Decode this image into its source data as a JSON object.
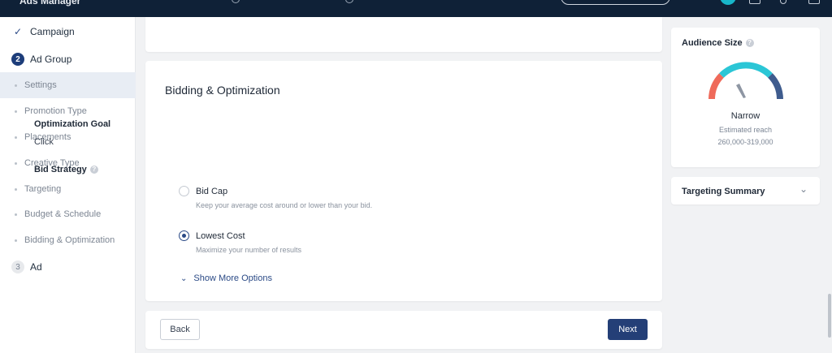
{
  "topbar": {
    "title": "Ads Manager"
  },
  "sidebar": {
    "steps": [
      {
        "num": "✓",
        "label": "Campaign"
      },
      {
        "num": "2",
        "label": "Ad Group"
      },
      {
        "num": "3",
        "label": "Ad"
      }
    ],
    "substeps": [
      "Settings",
      "Promotion Type",
      "Placements",
      "Creative Type",
      "Targeting",
      "Budget & Schedule",
      "Bidding & Optimization"
    ]
  },
  "main": {
    "title": "Bidding & Optimization",
    "optimization_goal": {
      "label": "Optimization Goal",
      "value": "Click"
    },
    "bid_strategy": {
      "label": "Bid Strategy",
      "options": [
        {
          "label": "Bid Cap",
          "desc": "Keep your average cost around or lower than your bid.",
          "selected": false
        },
        {
          "label": "Lowest Cost",
          "desc": "Maximize your number of results",
          "selected": true
        }
      ]
    },
    "show_more": "Show More Options",
    "back_label": "Back",
    "next_label": "Next"
  },
  "right": {
    "audience_title": "Audience Size",
    "gauge_status": "Narrow",
    "reach_label": "Estimated reach",
    "reach_value": "260,000-319,000",
    "targeting_summary": "Targeting Summary"
  },
  "colors": {
    "accent": "#1d3d7a",
    "gauge_low": "#ef6a5a",
    "gauge_mid": "#2bc6d6",
    "gauge_high": "#3f5c8e"
  }
}
